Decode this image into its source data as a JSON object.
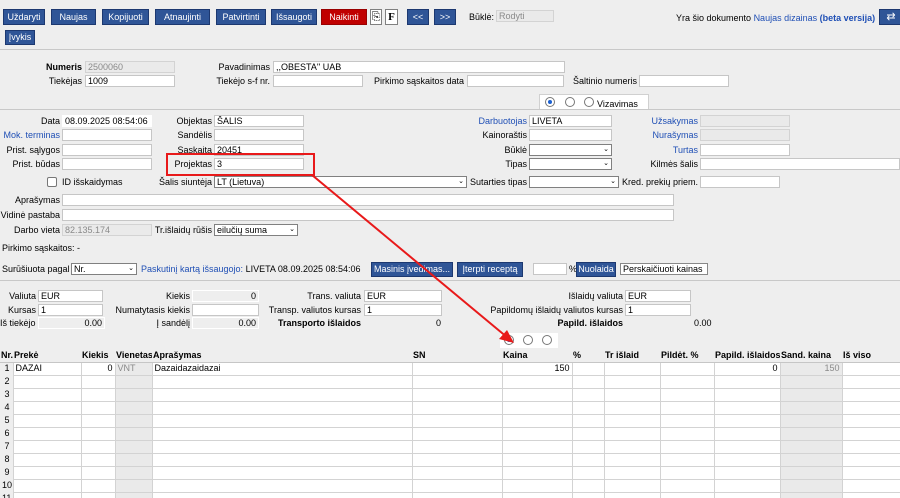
{
  "toolbar": {
    "uzdaryti": "Uždaryti",
    "naujas": "Naujas",
    "kopijuoti": "Kopijuoti",
    "atnaujinti": "Atnaujinti",
    "patvirtinti": "Patvirtinti",
    "issaugoti": "Išsaugoti",
    "naikinti": "Naikinti",
    "attach_icon": "paperclip-icon",
    "f_label": "F",
    "prev": "<<",
    "next": ">>",
    "bukle_label": "Būklė:",
    "bukle_value": "Rodyti",
    "info_prefix": "Yra šio dokumento",
    "info_link": "Naujas dizainas",
    "info_beta": "(beta versija)",
    "switch_icon": "swap-arrows-icon",
    "ivykis": "Įvykis"
  },
  "head": {
    "numeris_label": "Numeris",
    "numeris_value": "2500060",
    "pavadinimas_label": "Pavadinimas",
    "pavadinimas_value": ",,OBESTA'' UAB",
    "tiekejas_label": "Tiekėjas",
    "tiekejas_value": "1009",
    "tiekejo_sf_label": "Tiekėjo s-f nr.",
    "tiekejo_sf_value": "",
    "pirkimo_data_label": "Pirkimo sąskaitos data",
    "pirkimo_data_value": "",
    "saltinio_label": "Šaltinio numeris",
    "saltinio_value": ""
  },
  "tabs": {
    "vizavimas": "Vizavimas",
    "selected_index": 0
  },
  "form": {
    "data_label": "Data",
    "data_value": "08.09.2025 08:54:06",
    "objektas_label": "Objektas",
    "objektas_value": "ŠALIS",
    "darbuotojas_label": "Darbuotojas",
    "darbuotojas_value": "LIVETA",
    "uzsakymas_label": "Užsakymas",
    "uzsakymas_value": "",
    "mok_terminas_label": "Mok. terminas",
    "mok_terminas_value": "",
    "sandelis_label": "Sandėlis",
    "sandelis_value": "",
    "kainorastis_label": "Kainoraštis",
    "kainorastis_value": "",
    "nurasymas_label": "Nurašymas",
    "nurasymas_value": "",
    "prist_salygos_label": "Prist. sąlygos",
    "prist_salygos_value": "",
    "saskaita_label": "Sąskaita",
    "saskaita_value": "20451",
    "bukle_label": "Būklė",
    "bukle_value": "",
    "turtas_label": "Turtas",
    "turtas_value": "",
    "prist_budas_label": "Prist. būdas",
    "prist_budas_value": "",
    "projektas_label": "Projektas",
    "projektas_value": "3",
    "tipas_label": "Tipas",
    "tipas_value": "",
    "kilmes_salis_label": "Kilmės šalis",
    "kilmes_salis_value": "",
    "id_isskaidymas_label": "ID išskaidymas",
    "salis_siuntejo_label": "Šalis siuntėja",
    "salis_siuntejo_value": "LT (Lietuva)",
    "sutarties_tipas_label": "Sutarties tipas",
    "sutarties_tipas_value": "",
    "kred_priem_label": "Kred. prekių priem.",
    "kred_priem_value": "",
    "aprasymas_label": "Aprašymas",
    "aprasymas_value": "",
    "vidine_pastaba_label": "Vidinė pastaba",
    "vidine_pastaba_value": "",
    "darbo_vieta_label": "Darbo vieta",
    "darbo_vieta_value": "82.135.174",
    "tr_isl_rusis_label": "Tr.išlaidų rūšis",
    "tr_isl_rusis_value": "eilučių suma",
    "pirkimo_saskaitos": "Pirkimo sąskaitos: -"
  },
  "sort": {
    "label": "Surūšiuota pagal",
    "value": "Nr.",
    "last_saved_link": "Paskutinį kartą išsaugojo:",
    "last_saved_value": "LIVETA 08.09.2025 08:54:06",
    "masinis_btn": "Masinis įvedimas...",
    "iterpti_btn": "Įterpti receptą",
    "percent_label": "%",
    "nuolaida_btn": "Nuolaida",
    "perskaiciuoti_btn": "Perskaičiuoti kainas"
  },
  "totals": {
    "valiuta_label": "Valiuta",
    "valiuta_value": "EUR",
    "kiekis_label": "Kiekis",
    "kiekis_value": "0",
    "trans_valiuta_label": "Trans. valiuta",
    "trans_valiuta_value": "EUR",
    "islaidu_valiuta_label": "Išlaidų valiuta",
    "islaidu_valiuta_value": "EUR",
    "kursas_label": "Kursas",
    "kursas_value": "1",
    "numatytasis_label": "Numatytasis kiekis",
    "numatytasis_value": "",
    "transp_kursas_label": "Transp. valiutos kursas",
    "transp_kursas_value": "1",
    "papild_kursas_label": "Papildomų išlaidų valiutos kursas",
    "papild_kursas_value": "1",
    "is_tiekejo_label": "Iš tiekėjo",
    "is_tiekejo_value": "0.00",
    "i_sandeli_label": "Į sandėlį",
    "i_sandeli_value": "0.00",
    "transporto_label": "Transporto išlaidos",
    "transporto_value": "0",
    "papild_islaidos_label": "Papild. išlaidos",
    "papild_islaidos_value": "0.00"
  },
  "grid": {
    "headers": [
      "Nr.",
      "Prekė",
      "Kiekis",
      "Vienetas",
      "Aprašymas",
      "SN",
      "Kaina",
      "%",
      "Tr išlaid",
      "Pildėt. %",
      "Papild. išlaidos",
      "Sand. kaina",
      "Iš viso"
    ],
    "rows": [
      [
        "1",
        "DAZAI",
        "0",
        "VNT",
        "Dazaidazaidazai",
        "",
        "150",
        "",
        "",
        "",
        "0",
        "150",
        ""
      ],
      [
        "2",
        "",
        "",
        "",
        "",
        "",
        "",
        "",
        "",
        "",
        "",
        "",
        ""
      ],
      [
        "3",
        "",
        "",
        "",
        "",
        "",
        "",
        "",
        "",
        "",
        "",
        "",
        ""
      ],
      [
        "4",
        "",
        "",
        "",
        "",
        "",
        "",
        "",
        "",
        "",
        "",
        "",
        ""
      ],
      [
        "5",
        "",
        "",
        "",
        "",
        "",
        "",
        "",
        "",
        "",
        "",
        "",
        ""
      ],
      [
        "6",
        "",
        "",
        "",
        "",
        "",
        "",
        "",
        "",
        "",
        "",
        "",
        ""
      ],
      [
        "7",
        "",
        "",
        "",
        "",
        "",
        "",
        "",
        "",
        "",
        "",
        "",
        ""
      ],
      [
        "8",
        "",
        "",
        "",
        "",
        "",
        "",
        "",
        "",
        "",
        "",
        "",
        ""
      ],
      [
        "9",
        "",
        "",
        "",
        "",
        "",
        "",
        "",
        "",
        "",
        "",
        "",
        ""
      ],
      [
        "10",
        "",
        "",
        "",
        "",
        "",
        "",
        "",
        "",
        "",
        "",
        "",
        ""
      ],
      [
        "11",
        "",
        "",
        "",
        "",
        "",
        "",
        "",
        "",
        "",
        "",
        "",
        ""
      ]
    ]
  },
  "annotation": {
    "color": "#e8191a"
  }
}
